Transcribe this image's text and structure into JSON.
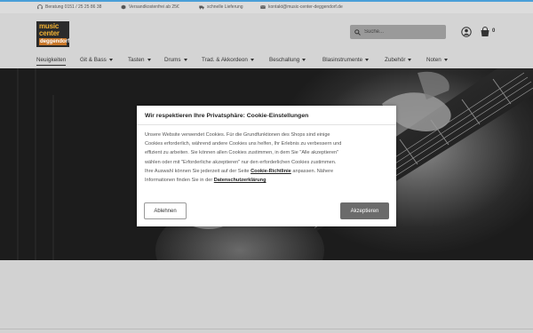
{
  "infobar": {
    "phone": "Beratung 0151 / 25 25 86 38",
    "shipping": "Versandkostenfrei ab 25€",
    "delivery": "schnelle Lieferung",
    "email": "kontakt@music-center-deggendorf.de"
  },
  "logo": {
    "line1": "music",
    "line2": "center",
    "line3": "deggendorf"
  },
  "search": {
    "placeholder": "Suche..."
  },
  "cart": {
    "count": "0"
  },
  "nav": [
    {
      "label": "Neuigkeiten",
      "caret": false
    },
    {
      "label": "Git & Bass",
      "caret": true
    },
    {
      "label": "Tasten",
      "caret": true
    },
    {
      "label": "Drums",
      "caret": true
    },
    {
      "label": "Trad. & Akkordeon",
      "caret": true
    },
    {
      "label": "Beschallung",
      "caret": true
    },
    {
      "label": "Blasinstrumente",
      "caret": true
    },
    {
      "label": "Zubehör",
      "caret": true
    },
    {
      "label": "Noten",
      "caret": true
    }
  ],
  "cookie": {
    "title": "Wir respektieren Ihre Privatsphäre: Cookie-Einstellungen",
    "body_lines": [
      "Unsere Website verwendet Cookies. Für die Grundfunktionen des Shops sind einige",
      "Cookies erforderlich, während andere Cookies uns helfen, Ihr Erlebnis zu verbessern und",
      "effizient zu arbeiten. Sie können allen Cookies zustimmen, in dem Sie \"Alle akzeptieren\"",
      "wählen oder mit \"Erforderliche akzeptieren\" nur den erforderlichen Cookies zustimmen."
    ],
    "line5_pre": "Ihre Auswahl können Sie jederzeit auf der Seite ",
    "policy_link": "Cookie-Richtlinie",
    "line5_post": " anpassen. Nähere",
    "line6_pre": "Informationen finden Sie in der ",
    "privacy_link": "Datenschutzerklärung",
    "decline_label": "Ablehnen",
    "accept_label": "Akzeptieren"
  },
  "colors": {
    "accent": "#4a9fd8",
    "accept_button": "#6b6b6b",
    "logo_orange": "#f2b233"
  }
}
